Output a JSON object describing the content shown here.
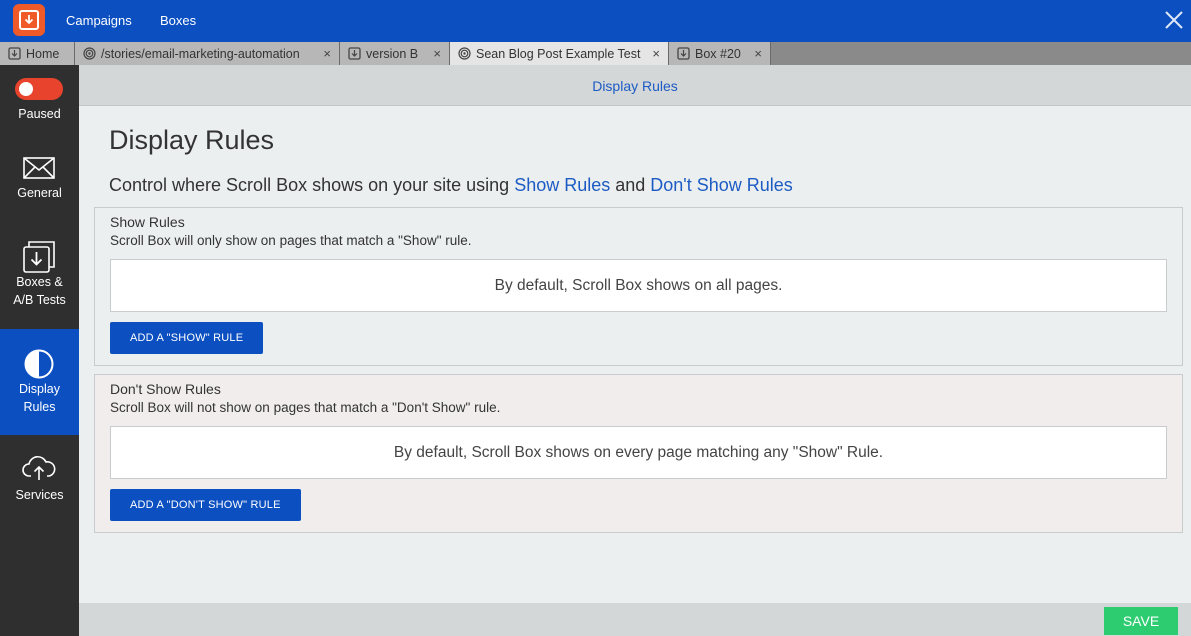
{
  "topbar": {
    "nav": [
      "Campaigns",
      "Boxes"
    ]
  },
  "tabs": [
    {
      "label": "Home",
      "icon": "box-icon"
    },
    {
      "label": "/stories/email-marketing-automation",
      "icon": "target-icon"
    },
    {
      "label": "version B",
      "icon": "box-icon"
    },
    {
      "label": "Sean Blog Post Example Test",
      "icon": "target-icon",
      "active": true
    },
    {
      "label": "Box #20",
      "icon": "box-icon"
    }
  ],
  "tab_close": "×",
  "sidebar": {
    "status": "Paused",
    "items": [
      {
        "label_lines": [
          "General"
        ],
        "icon": "envelope-icon"
      },
      {
        "label_lines": [
          "Boxes &",
          "A/B Tests"
        ],
        "icon": "download-box-icon"
      },
      {
        "label_lines": [
          "Display",
          "Rules"
        ],
        "icon": "half-circle-icon",
        "active": true
      },
      {
        "label_lines": [
          "Services"
        ],
        "icon": "cloud-upload-icon"
      }
    ]
  },
  "main": {
    "subheader": "Display Rules",
    "title": "Display Rules",
    "intro_prefix": "Control where Scroll Box shows on your site using ",
    "intro_show_link": "Show Rules",
    "intro_and": " and ",
    "intro_dont_link": "Don't Show Rules",
    "show_panel": {
      "title": "Show Rules",
      "description": "Scroll Box will only show on pages that match a \"Show\" rule.",
      "empty_text": "By default, Scroll Box shows on all pages.",
      "button": "ADD A \"SHOW\" RULE"
    },
    "dont_panel": {
      "title": "Don't Show Rules",
      "description": "Scroll Box will not show on pages that match a \"Don't Show\" rule.",
      "empty_text": "By default, Scroll Box shows on every page matching any \"Show\" Rule.",
      "button": "ADD A \"DON'T SHOW\" RULE"
    },
    "save": "SAVE"
  },
  "colors": {
    "brand_blue": "#0b4fc1",
    "logo_orange": "#f05a28",
    "toggle_red": "#e8432c",
    "save_green": "#2ecc71",
    "link_blue": "#1c5bc4"
  }
}
